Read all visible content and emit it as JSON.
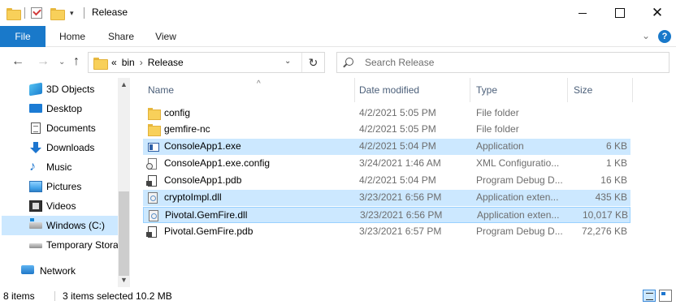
{
  "window": {
    "title": "Release",
    "quick_access_dropdown": "▾",
    "minimize": "",
    "maximize": "",
    "close": "✕"
  },
  "ribbon": {
    "tabs": [
      "File",
      "Home",
      "Share",
      "View"
    ],
    "expand": "⌄",
    "help": "?"
  },
  "address": {
    "back": "←",
    "forward": "→",
    "recent": "⌄",
    "up": "↑",
    "overflow": "«",
    "crumbs": [
      "bin",
      "Release"
    ],
    "crumb_separator": "›",
    "dropdown": "⌄",
    "refresh": "↻"
  },
  "search": {
    "placeholder": "Search Release",
    "value": ""
  },
  "nav_pane": {
    "items": [
      {
        "label": "3D Objects",
        "icon": "3d-objects-icon"
      },
      {
        "label": "Desktop",
        "icon": "desktop-icon"
      },
      {
        "label": "Documents",
        "icon": "documents-icon"
      },
      {
        "label": "Downloads",
        "icon": "downloads-icon"
      },
      {
        "label": "Music",
        "icon": "music-icon"
      },
      {
        "label": "Pictures",
        "icon": "pictures-icon"
      },
      {
        "label": "Videos",
        "icon": "videos-icon"
      },
      {
        "label": "Windows (C:)",
        "icon": "drive-icon",
        "selected": true
      },
      {
        "label": "Temporary Stora",
        "icon": "drive-icon"
      },
      {
        "label": "Network",
        "icon": "network-icon"
      }
    ],
    "scroll_up": "▲",
    "scroll_down": "▼"
  },
  "columns": {
    "name": "Name",
    "date": "Date modified",
    "type": "Type",
    "size": "Size",
    "sort_indicator": "^"
  },
  "files": [
    {
      "name": "config",
      "date": "4/2/2021 5:05 PM",
      "type": "File folder",
      "size": "",
      "icon": "folder-icon",
      "selected": false
    },
    {
      "name": "gemfire-nc",
      "date": "4/2/2021 5:05 PM",
      "type": "File folder",
      "size": "",
      "icon": "folder-icon",
      "selected": false
    },
    {
      "name": "ConsoleApp1.exe",
      "date": "4/2/2021 5:04 PM",
      "type": "Application",
      "size": "6 KB",
      "icon": "exe-icon",
      "selected": true
    },
    {
      "name": "ConsoleApp1.exe.config",
      "date": "3/24/2021 1:46 AM",
      "type": "XML Configuratio...",
      "size": "1 KB",
      "icon": "config-file-icon",
      "selected": false
    },
    {
      "name": "ConsoleApp1.pdb",
      "date": "4/2/2021 5:04 PM",
      "type": "Program Debug D...",
      "size": "16 KB",
      "icon": "pdb-file-icon",
      "selected": false
    },
    {
      "name": "cryptoImpl.dll",
      "date": "3/23/2021 6:56 PM",
      "type": "Application exten...",
      "size": "435 KB",
      "icon": "dll-icon",
      "selected": true
    },
    {
      "name": "Pivotal.GemFire.dll",
      "date": "3/23/2021 6:56 PM",
      "type": "Application exten...",
      "size": "10,017 KB",
      "icon": "dll-icon",
      "selected": true,
      "focused": true
    },
    {
      "name": "Pivotal.GemFire.pdb",
      "date": "3/23/2021 6:57 PM",
      "type": "Program Debug D...",
      "size": "72,276 KB",
      "icon": "pdb-file-icon",
      "selected": false
    }
  ],
  "status": {
    "item_count": "8 items",
    "selection": "3 items selected  10.2 MB"
  },
  "colors": {
    "accent": "#1979ca",
    "selection": "#cce8ff",
    "focus_border": "#99d1ff"
  }
}
